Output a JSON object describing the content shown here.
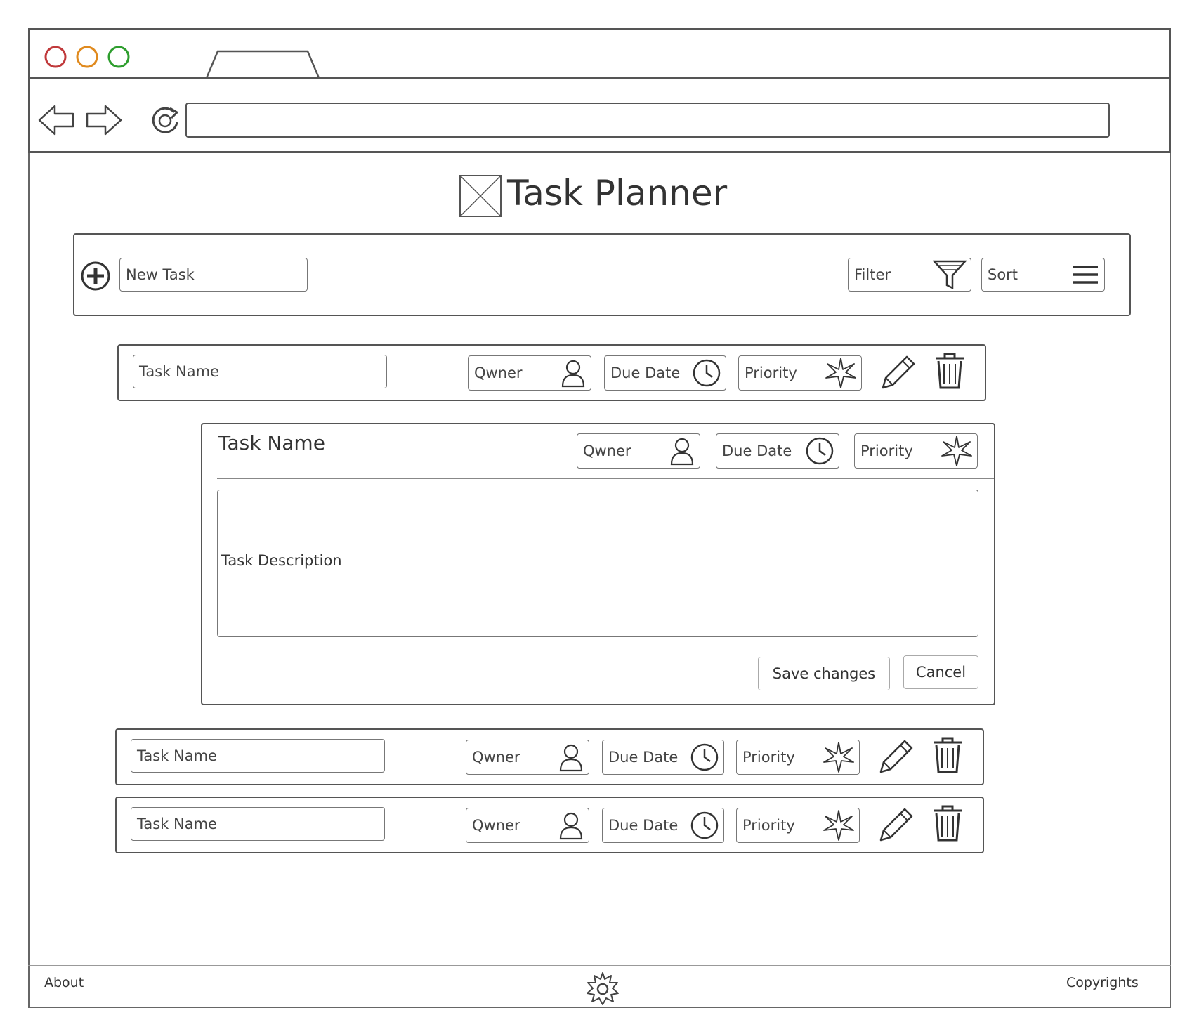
{
  "browser": {
    "window_controls": {
      "close_color": "#c0393b",
      "minimize_color": "#e08a1e",
      "maximize_color": "#2e9e2e"
    },
    "address_bar": {
      "value": ""
    }
  },
  "page": {
    "logo_icon": "image-placeholder-icon",
    "title": "Task Planner"
  },
  "toolbar": {
    "new_task_placeholder": "New Task",
    "add_icon": "plus-circle-icon",
    "filter_label": "Filter",
    "filter_icon": "funnel-icon",
    "sort_label": "Sort",
    "sort_icon": "hamburger-icon"
  },
  "tasks": [
    {
      "name": "Task Name",
      "owner": "Qwner",
      "due": "Due Date",
      "priority": "Priority"
    },
    {
      "name": "Task Name",
      "owner": "Qwner",
      "due": "Due Date",
      "priority": "Priority"
    },
    {
      "name": "Task Name",
      "owner": "Qwner",
      "due": "Due Date",
      "priority": "Priority"
    }
  ],
  "editor": {
    "title": "Task Name",
    "owner": "Qwner",
    "due": "Due Date",
    "priority": "Priority",
    "description": "Task Description",
    "save_label": "Save changes",
    "cancel_label": "Cancel"
  },
  "footer": {
    "about": "About",
    "center_icon": "gear-icon",
    "copyrights": "Copyrights"
  }
}
